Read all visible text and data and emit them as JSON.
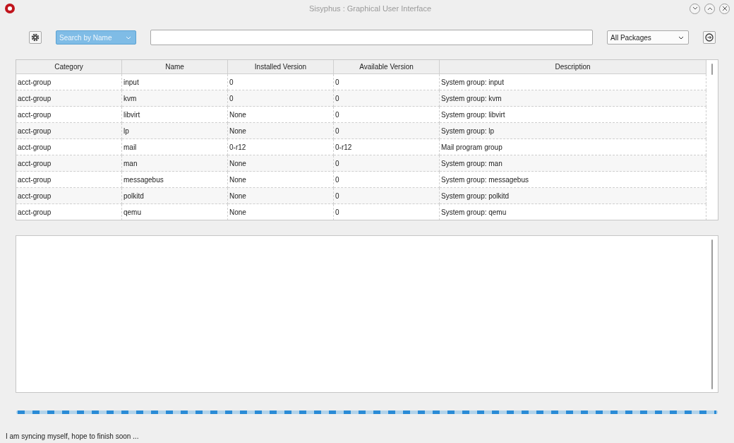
{
  "window": {
    "title": "Sisyphus : Graphical User Interface"
  },
  "toolbar": {
    "search_mode": "Search by Name",
    "filter": "All Packages"
  },
  "table": {
    "columns": [
      "Category",
      "Name",
      "Installed Version",
      "Available Version",
      "Description"
    ],
    "rows": [
      [
        "acct-group",
        "input",
        "0",
        "0",
        "System group: input"
      ],
      [
        "acct-group",
        "kvm",
        "0",
        "0",
        "System group: kvm"
      ],
      [
        "acct-group",
        "libvirt",
        "None",
        "0",
        "System group: libvirt"
      ],
      [
        "acct-group",
        "lp",
        "None",
        "0",
        "System group: lp"
      ],
      [
        "acct-group",
        "mail",
        "0-r12",
        "0-r12",
        "Mail program group"
      ],
      [
        "acct-group",
        "man",
        "None",
        "0",
        "System group: man"
      ],
      [
        "acct-group",
        "messagebus",
        "None",
        "0",
        "System group: messagebus"
      ],
      [
        "acct-group",
        "polkitd",
        "None",
        "0",
        "System group: polkitd"
      ],
      [
        "acct-group",
        "qemu",
        "None",
        "0",
        "System group: qemu"
      ]
    ]
  },
  "progress": {
    "busy": true
  },
  "status_bar": "I am syncing myself, hope to finish soon ..."
}
